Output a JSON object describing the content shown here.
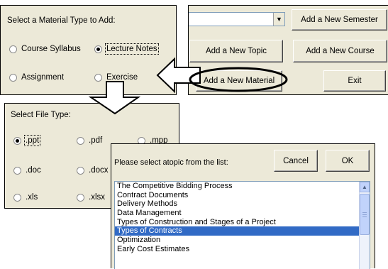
{
  "material_panel": {
    "title": "Select a Material Type to Add:",
    "options": [
      {
        "label": "Course Syllabus",
        "selected": false
      },
      {
        "label": "Lecture Notes",
        "selected": true
      },
      {
        "label": "Assignment",
        "selected": false
      },
      {
        "label": "Exercise",
        "selected": false
      }
    ]
  },
  "main_panel": {
    "combo_value": "",
    "buttons": {
      "add_semester": "Add a New Semester",
      "add_topic": "Add a New Topic",
      "add_course": "Add a New Course",
      "add_material": "Add a New Material",
      "exit": "Exit"
    }
  },
  "file_panel": {
    "title": "Select File Type:",
    "options": [
      {
        "label": ".ppt",
        "selected": true
      },
      {
        "label": ".pdf",
        "selected": false
      },
      {
        "label": ".mpp",
        "selected": false
      },
      {
        "label": ".doc",
        "selected": false
      },
      {
        "label": ".docx",
        "selected": false
      },
      {
        "label": ".xls",
        "selected": false
      },
      {
        "label": ".xlsx",
        "selected": false
      }
    ]
  },
  "topic_dialog": {
    "prompt": "Please select atopic from the list:",
    "cancel": "Cancel",
    "ok": "OK",
    "topics": [
      "The Competitive Bidding Process",
      "Contract Documents",
      "Delivery Methods",
      "Data Management",
      "Types of Construction and Stages of a Project",
      "Types of Contracts",
      "Optimization",
      "Early Cost Estimates"
    ],
    "selected_index": 5
  },
  "colors": {
    "panel_bg": "#ece9d8",
    "selection": "#316ac5",
    "arrow_fill": "#ffffff"
  }
}
